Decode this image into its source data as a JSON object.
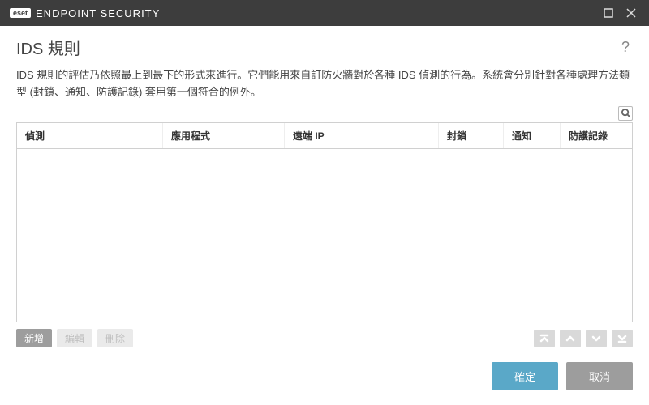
{
  "titlebar": {
    "brand_badge": "eset",
    "brand_text": "ENDPOINT SECURITY"
  },
  "page": {
    "title": "IDS 規則",
    "description": "IDS 規則的評估乃依照最上到最下的形式來進行。它們能用來自訂防火牆對於各種 IDS 偵測的行為。系統會分別針對各種處理方法類型 (封鎖、通知、防護記錄) 套用第一個符合的例外。"
  },
  "table": {
    "columns": [
      "偵測",
      "應用程式",
      "遠端 IP",
      "封鎖",
      "通知",
      "防護記錄"
    ],
    "rows": []
  },
  "actions": {
    "add": "新增",
    "edit": "編輯",
    "delete": "刪除"
  },
  "footer": {
    "ok": "確定",
    "cancel": "取消"
  }
}
